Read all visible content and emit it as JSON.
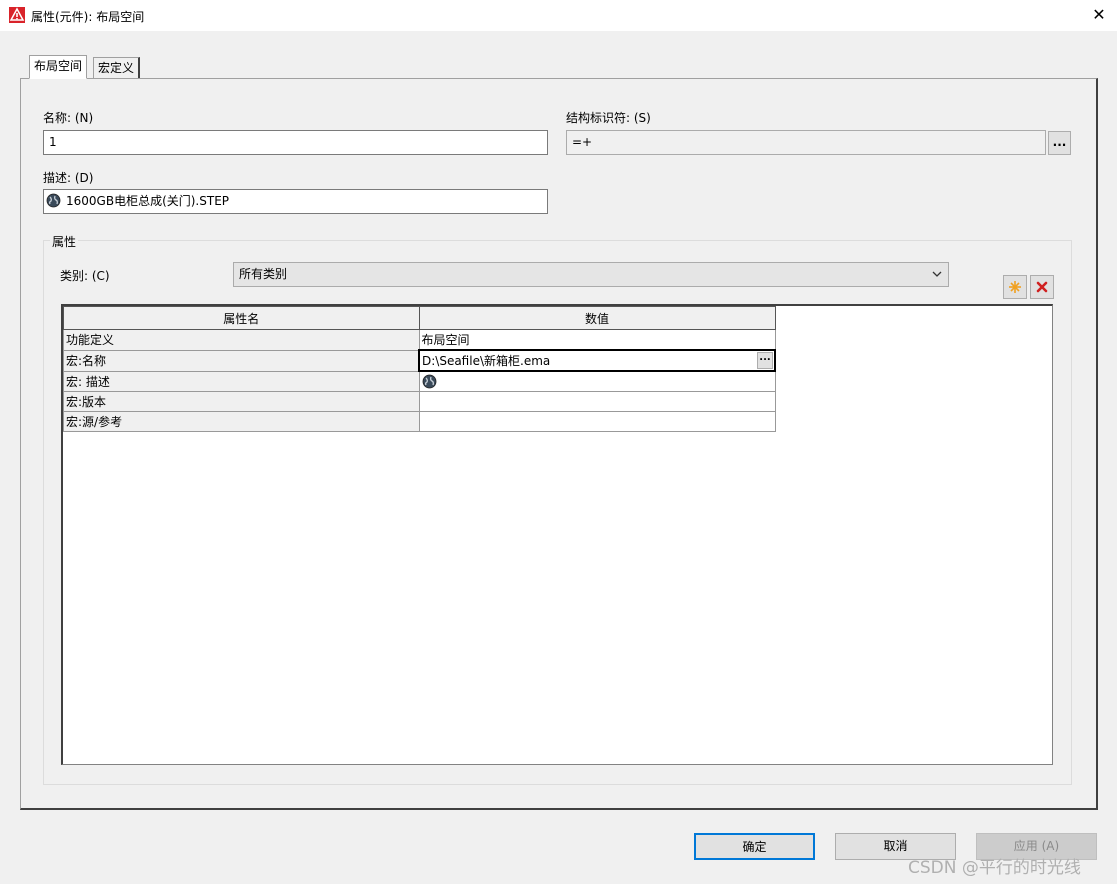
{
  "window": {
    "title": "属性(元件): 布局空间",
    "close": "✕"
  },
  "tabs": [
    {
      "label": "布局空间"
    },
    {
      "label": "宏定义"
    }
  ],
  "form": {
    "name_label": "名称: (N)",
    "name_value": "1",
    "struct_label": "结构标识符: (S)",
    "struct_value": "=+",
    "struct_btn": "...",
    "desc_label": "描述: (D)",
    "desc_value": "1600GB电柜总成(关门).STEP"
  },
  "props": {
    "group_title": "属性",
    "category_label": "类别: (C)",
    "category_value": "所有类别",
    "col_name": "属性名",
    "col_value": "数值",
    "rows": [
      {
        "name": "功能定义",
        "value": "布局空间"
      },
      {
        "name": "宏:名称",
        "value": "D:\\Seafile\\新箱柜.ema"
      },
      {
        "name": "宏: 描述",
        "value": ""
      },
      {
        "name": "宏:版本",
        "value": ""
      },
      {
        "name": "宏:源/参考",
        "value": ""
      }
    ],
    "cell_btn": "..."
  },
  "footer": {
    "ok": "确定",
    "cancel": "取消",
    "apply": "应用 (A)"
  },
  "watermark": "CSDN @平行的时光线"
}
